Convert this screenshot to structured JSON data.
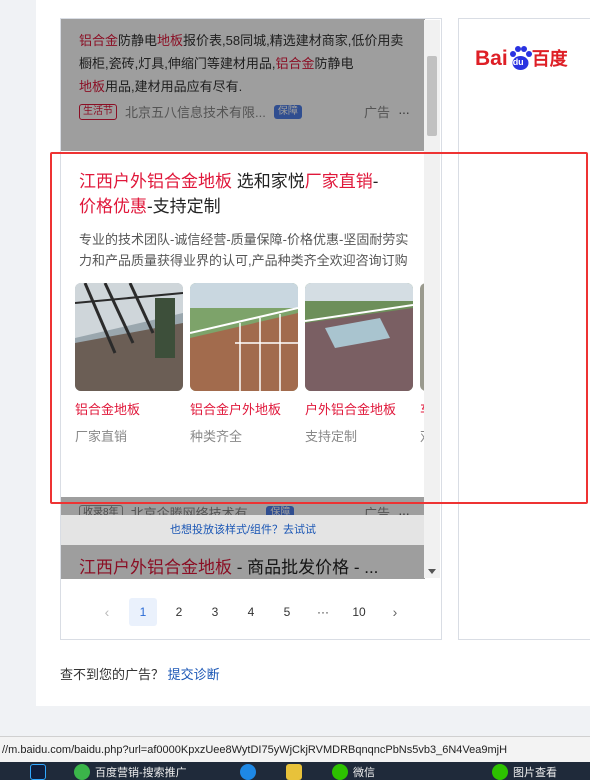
{
  "ad1": {
    "desc_parts": [
      "铝合金",
      "防静电",
      "地板",
      "报价表,58同城,精选建材商家,低价用卖橱柜,瓷砖,灯具,伸缩门等建材用品,",
      "铝合金",
      "防静电",
      "地板",
      "用品,建材用品应有尽有."
    ],
    "tag": "生活节",
    "company": "北京五八信息技术有限...",
    "badge": "保障",
    "ad_label": "广告",
    "more": "···"
  },
  "ad2": {
    "title_a": "江西户外铝合金地板",
    "title_b": " 选和家悦",
    "title_c": "厂家直销",
    "title_d": "-",
    "title_e": "价格优惠",
    "title_f": "-支持定制",
    "desc": "专业的技术团队-诚信经营-质量保障-价格优惠-坚固耐劳实力和产品质量获得业界的认可,产品种类齐全欢迎咨询订购",
    "items": [
      {
        "name": "铝合金地板",
        "sub": "厂家直销"
      },
      {
        "name": "铝合金户外地板",
        "sub": "种类齐全"
      },
      {
        "name": "户外铝合金地板",
        "sub": "支持定制"
      },
      {
        "name": "车",
        "sub": "双"
      }
    ],
    "tag": "收录8年",
    "company": "北京企腾网络技术有...",
    "badge": "保障",
    "ad_label": "广告",
    "more": "···"
  },
  "try_bar": "也想投放该样式/组件？去试试",
  "ad3": {
    "title_a": "江西户外铝合金地板",
    "title_b": " - 商品批发价格 - ..."
  },
  "pagination": {
    "prev": "‹",
    "pages": [
      "1",
      "2",
      "3",
      "4",
      "5"
    ],
    "ellipsis": "···",
    "last": "10",
    "next": "›",
    "current": "1"
  },
  "logo": {
    "text_a": "Bai",
    "text_du": "du",
    "text_b": "百度"
  },
  "help": {
    "text": "查不到您的广告？",
    "link": "提交诊断"
  },
  "status_url": "//m.baidu.com/baidu.php?url=af0000KpxzUee8WytDI75yWjCkjRVMDRBqnqncPbNs5vb3_6N4Vea9mjH",
  "taskbar": {
    "item1": "百度营销-搜索推广",
    "item2": "微信",
    "item3": "图片查看"
  },
  "colors": {
    "accent_red": "#e0173a",
    "link_blue": "#1a56b5",
    "highlight_red": "#e33"
  }
}
